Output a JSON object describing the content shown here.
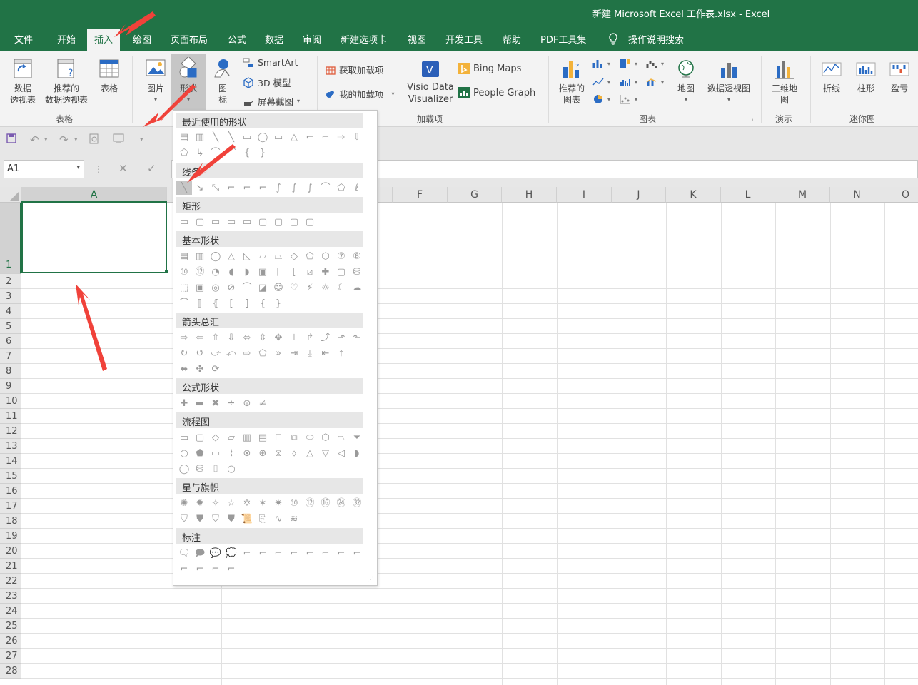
{
  "window": {
    "title": "新建 Microsoft Excel 工作表.xlsx  -  Excel"
  },
  "tabs": [
    "文件",
    "开始",
    "插入",
    "绘图",
    "页面布局",
    "公式",
    "数据",
    "审阅",
    "新建选项卡",
    "视图",
    "开发工具",
    "帮助",
    "PDF工具集",
    "操作说明搜索"
  ],
  "ribbon": {
    "pivot_table": "数据\n透视表",
    "recommended_pivot": "推荐的\n数据透视表",
    "table": "表格",
    "group_tables": "表格",
    "picture": "图片",
    "shapes": "形状",
    "icons": "图\n标",
    "smartart": "SmartArt",
    "model3d": "3D 模型",
    "screenshot": "屏幕截图",
    "get_addins": "获取加载项",
    "my_addins": "我的加载项",
    "visio": "Visio Data\nVisualizer",
    "bing": "Bing Maps",
    "people": "People Graph",
    "group_addins": "加载项",
    "rec_charts": "推荐的\n图表",
    "map": "地图",
    "pivot_chart": "数据透视图",
    "group_charts": "图表",
    "map3d": "三维地\n图",
    "group_tours": "演示",
    "line": "折线",
    "column": "柱形",
    "winloss": "盈亏",
    "group_sparklines": "迷你图"
  },
  "namebox": "A1",
  "columns": [
    "A",
    "F",
    "G",
    "H",
    "I",
    "J",
    "K",
    "L",
    "M",
    "N",
    "O"
  ],
  "rows": [
    "1",
    "2",
    "3",
    "4",
    "5",
    "6",
    "7",
    "8",
    "9",
    "10",
    "11",
    "12",
    "13",
    "14",
    "15",
    "16",
    "17",
    "18",
    "19",
    "20",
    "21",
    "22",
    "23",
    "24",
    "25",
    "26",
    "27",
    "28"
  ],
  "gallery": {
    "sections": [
      "最近使用的形状",
      "线条",
      "矩形",
      "基本形状",
      "箭头总汇",
      "公式形状",
      "流程图",
      "星与旗帜",
      "标注"
    ]
  },
  "colors": {
    "accent": "#217346",
    "arrow": "#f0423a"
  }
}
